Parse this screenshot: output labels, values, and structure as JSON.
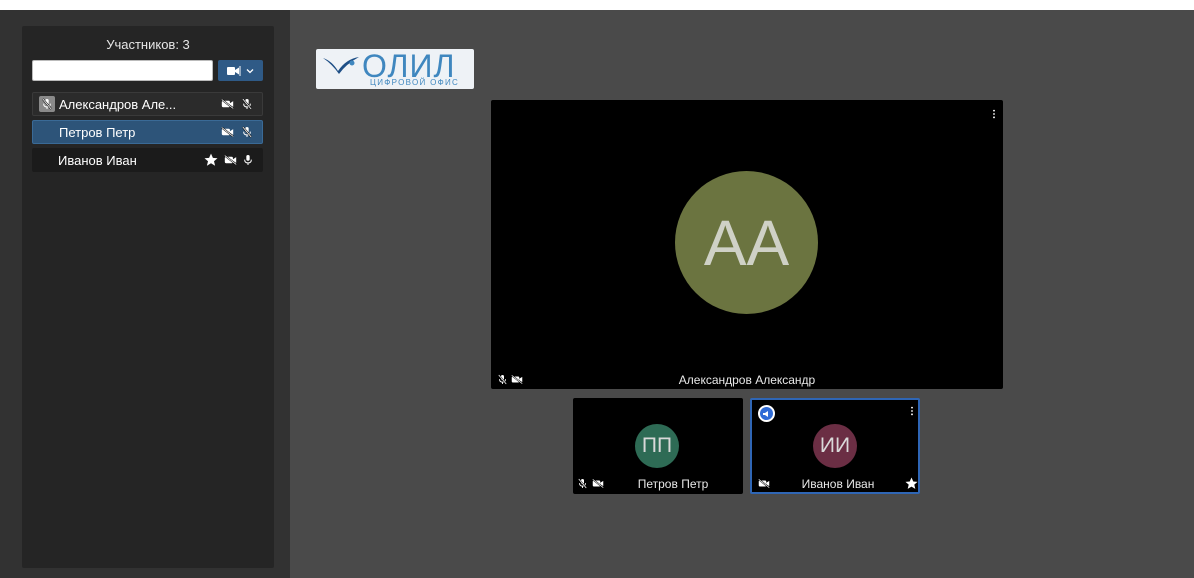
{
  "participants_panel": {
    "count_label": "Участников: 3",
    "search": {
      "value": "",
      "placeholder": ""
    },
    "filter_icon": "camera-filter-icon",
    "participants": [
      {
        "name": "Александров Але...",
        "muted_badge": true,
        "star": false,
        "camera_off": true,
        "mic": "off"
      },
      {
        "name": "Петров Петр",
        "selected": true,
        "star": false,
        "camera_off": true,
        "mic": "off"
      },
      {
        "name": "Иванов Иван",
        "star": true,
        "camera_off": true,
        "mic": "on"
      }
    ]
  },
  "logo": {
    "text": "ОЛИЛ",
    "subtitle": "ЦИФРОВОЙ ОФИС"
  },
  "main_video": {
    "initials": "АА",
    "name": "Александров Александр",
    "avatar_color": "#6b7440",
    "mic": "off",
    "camera_off": true
  },
  "thumbnails": [
    {
      "initials": "ПП",
      "name": "Петров Петр",
      "avatar_color": "#2e6b55",
      "mic": "off",
      "camera_off": true,
      "speaking": false
    },
    {
      "initials": "ИИ",
      "name": "Иванов Иван",
      "avatar_color": "#6b2e44",
      "camera_off": true,
      "star": true,
      "speaking": true
    }
  ],
  "colors": {
    "accent": "#2d5479",
    "active_border": "#2f66b5",
    "background": "#4a4a4a"
  }
}
